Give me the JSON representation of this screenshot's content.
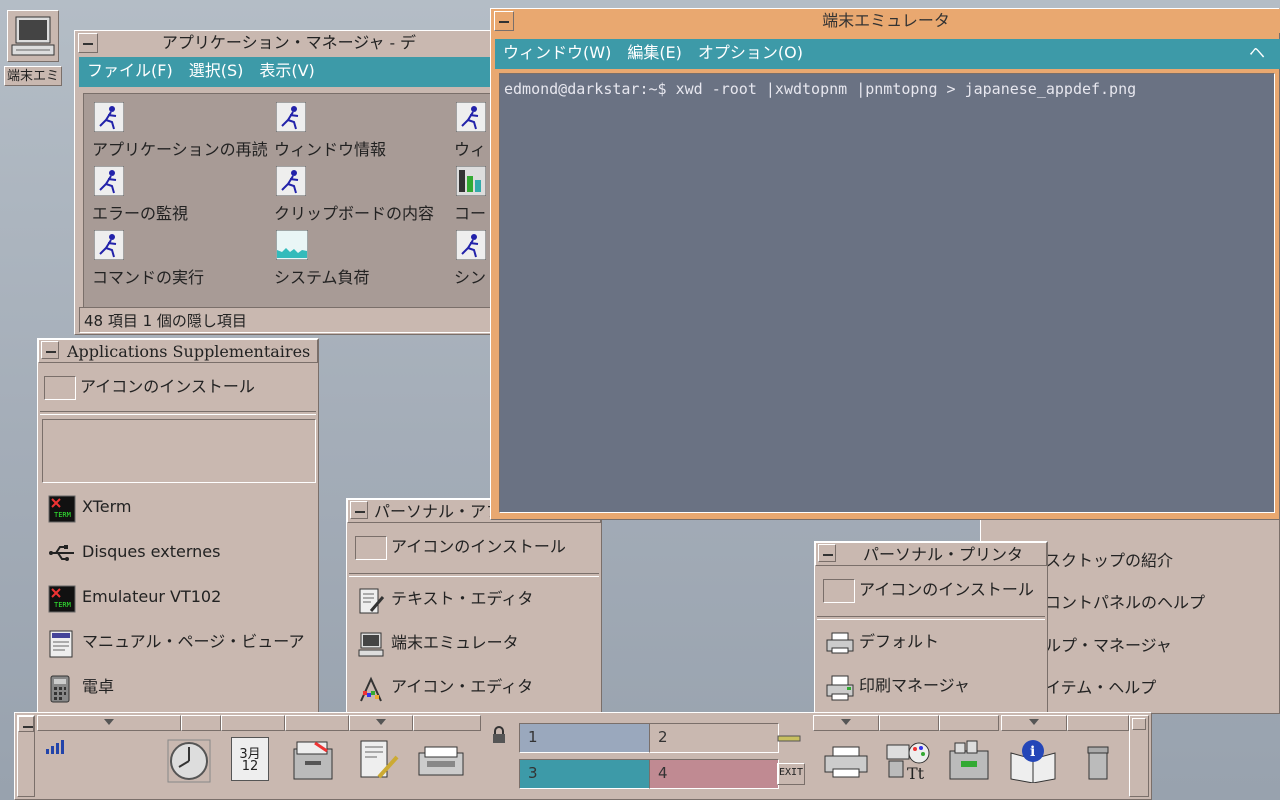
{
  "desktop_icon": {
    "label": "端末エミ"
  },
  "app_manager": {
    "title": "アプリケーション・マネージャ - デ",
    "menu": [
      "ファイル(F)",
      "選択(S)",
      "表示(V)"
    ],
    "items": [
      {
        "label": "アプリケーションの再読",
        "icon": "runner-icon"
      },
      {
        "label": "ウィンドウ情報",
        "icon": "runner-icon"
      },
      {
        "label": "ウィ",
        "icon": "runner-icon"
      },
      {
        "label": "エラーの監視",
        "icon": "runner-icon"
      },
      {
        "label": "クリップボードの内容",
        "icon": "runner-icon"
      },
      {
        "label": "コー",
        "icon": "color-chart-icon"
      },
      {
        "label": "コマンドの実行",
        "icon": "runner-icon"
      },
      {
        "label": "システム負荷",
        "icon": "load-graph-icon"
      },
      {
        "label": "シン",
        "icon": "runner-icon"
      }
    ],
    "status": "48 項目 1 個の隠し項目"
  },
  "terminal": {
    "title": "端末エミュレータ",
    "menu": [
      "ウィンドウ(W)",
      "編集(E)",
      "オプション(O)"
    ],
    "help_menu": "ヘルプ",
    "line": "edmond@darkstar:~$ xwd -root |xwdtopnm |pnmtopng > japanese_appdef.png"
  },
  "subpanel_supp": {
    "title": "Applications Supplementaires",
    "install": "アイコンのインストール",
    "items": [
      {
        "label": "XTerm",
        "icon": "xterm-icon"
      },
      {
        "label": "Disques externes",
        "icon": "usb-icon"
      },
      {
        "label": "Emulateur VT102",
        "icon": "xterm-icon"
      },
      {
        "label": "マニュアル・ページ・ビューア",
        "icon": "manpage-icon"
      },
      {
        "label": "電卓",
        "icon": "calculator-icon"
      }
    ]
  },
  "subpanel_personal": {
    "title": "パーソナル・アプ",
    "install": "アイコンのインストール",
    "items": [
      {
        "label": "テキスト・エディタ",
        "icon": "text-editor-icon"
      },
      {
        "label": "端末エミュレータ",
        "icon": "terminal-icon"
      },
      {
        "label": "アイコン・エディタ",
        "icon": "icon-editor-icon"
      }
    ]
  },
  "subpanel_printer": {
    "title": "パーソナル・プリンタ",
    "install": "アイコンのインストール",
    "items": [
      {
        "label": "デフォルト",
        "icon": "printer-icon"
      },
      {
        "label": "印刷マネージャ",
        "icon": "print-manager-icon"
      }
    ]
  },
  "subpanel_help": {
    "items": [
      "スクトップの紹介",
      "コントパネルのヘルプ",
      "ルプ・マネージャ",
      "イテム・ヘルプ"
    ]
  },
  "front_panel": {
    "calendar_month": "3月",
    "calendar_day": "12",
    "workspaces": [
      {
        "label": "1",
        "color": "#9aa8bd"
      },
      {
        "label": "2",
        "color": "#c9b8b0"
      },
      {
        "label": "3",
        "color": "#3d9aa8"
      },
      {
        "label": "4",
        "color": "#c08a92"
      }
    ],
    "exit_label": "EXIT"
  },
  "colors": {
    "accent": "#3d9aa8",
    "terminal_title": "#e9a870",
    "panel": "#c9b8b0",
    "terminal_bg": "#6a7283"
  }
}
